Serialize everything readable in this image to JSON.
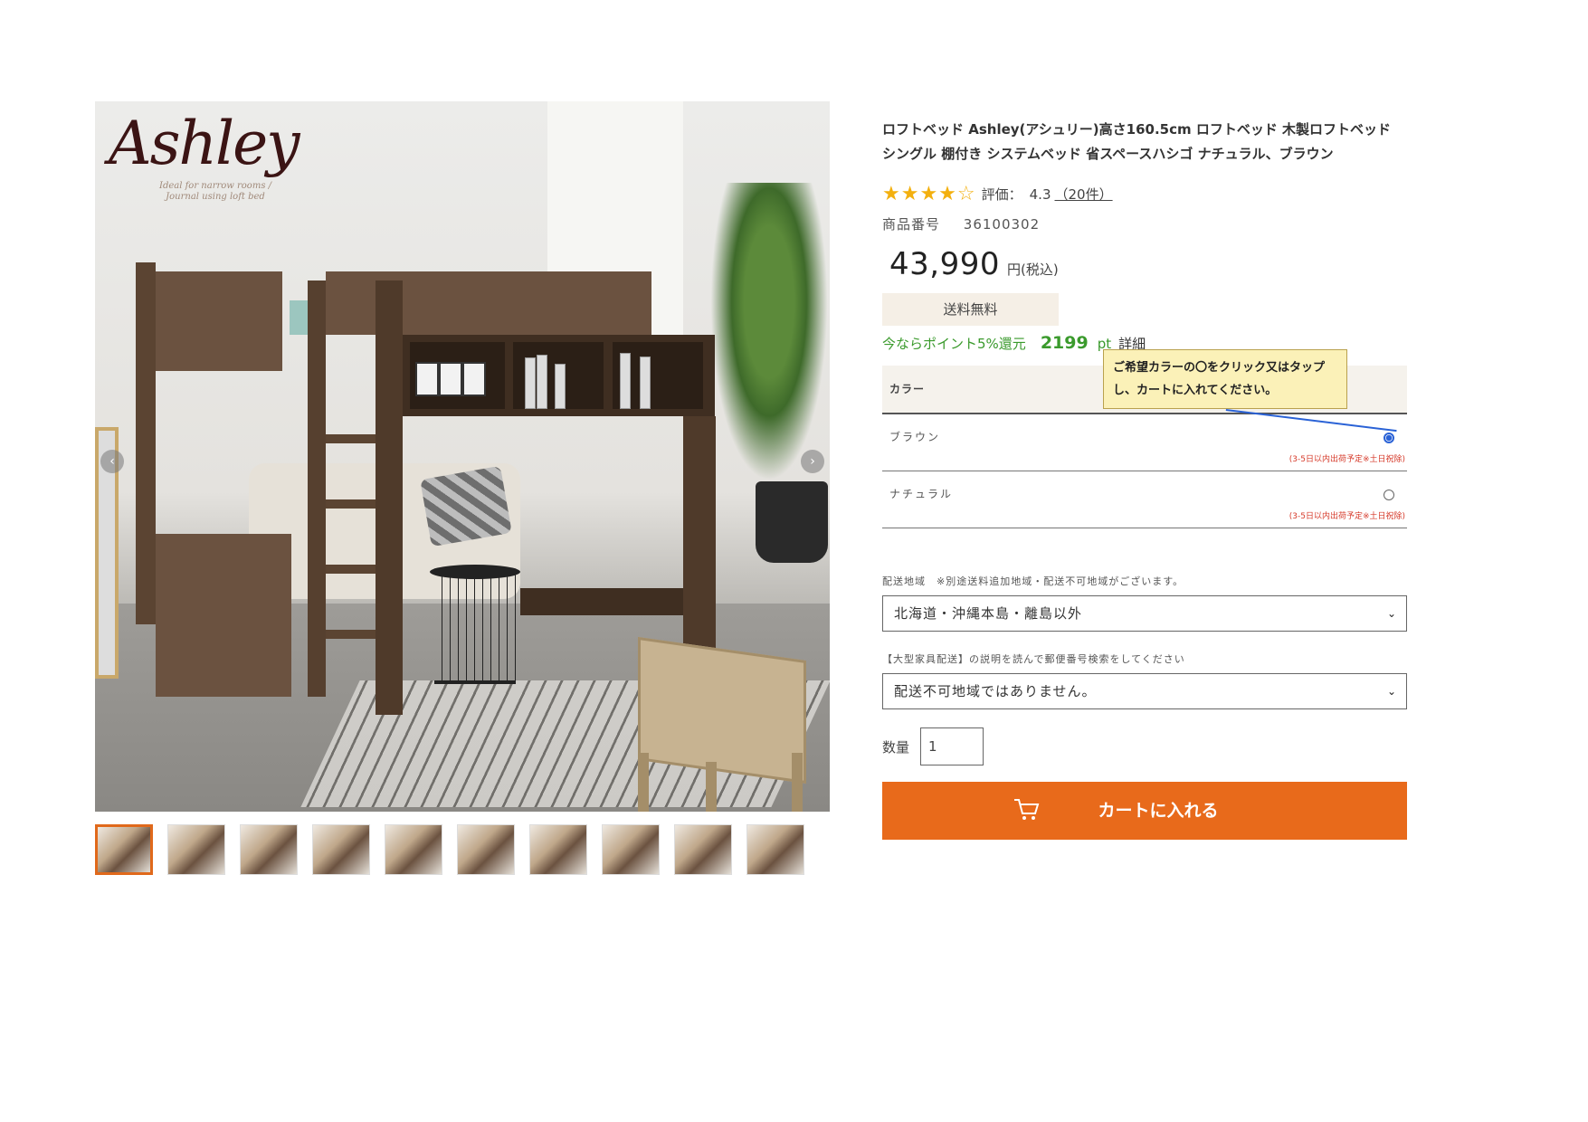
{
  "gallery": {
    "logo_text": "Ashley",
    "logo_sub": "Ideal for narrow rooms / Journal using loft bed",
    "prev_arrow": "‹",
    "next_arrow": "›",
    "thumbnail_count": 10
  },
  "product": {
    "title": "ロフトベッド Ashley(アシュリー)高さ160.5cm ロフトベッド 木製ロフトベッド シングル 棚付き システムベッド 省スペースハシゴ ナチュラル、ブラウン",
    "stars": "★★★★",
    "star_empty": "☆",
    "rating_label": "評価：",
    "rating_value": "4.3",
    "rating_count": "（20件）",
    "sku_label": "商品番号",
    "sku": "36100302",
    "price": "43,990",
    "price_unit": "円(税込)",
    "free_shipping": "送料無料",
    "points_text": "今ならポイント5%還元",
    "points": "2199",
    "points_unit": "pt",
    "points_detail": "詳細"
  },
  "color": {
    "header": "カラー",
    "tooltip": "ご希望カラーの〇をクリック又はタップし、カートに入れてください。",
    "options": [
      {
        "name": "ブラウン",
        "note": "(3-5日以内出荷予定※土日祝除)",
        "selected": true
      },
      {
        "name": "ナチュラル",
        "note": "(3-5日以内出荷予定※土日祝除)",
        "selected": false
      }
    ]
  },
  "delivery": {
    "region_label": "配送地域　※別途送料追加地域・配送不可地域がございます。",
    "region_value": "北海道・沖縄本島・離島以外",
    "postal_label": "【大型家具配送】の説明を読んで郵便番号検索をしてください",
    "postal_value": "配送不可地域ではありません。",
    "chevron": "⌄"
  },
  "quantity": {
    "label": "数量",
    "value": "1"
  },
  "cart": {
    "label": "カートに入れる"
  },
  "colors": {
    "accent": "#e86a1b",
    "points_green": "#3a9a2c",
    "note_red": "#d63a2a",
    "radio_blue": "#2a62d6",
    "tooltip_bg": "#fbf1b8"
  }
}
